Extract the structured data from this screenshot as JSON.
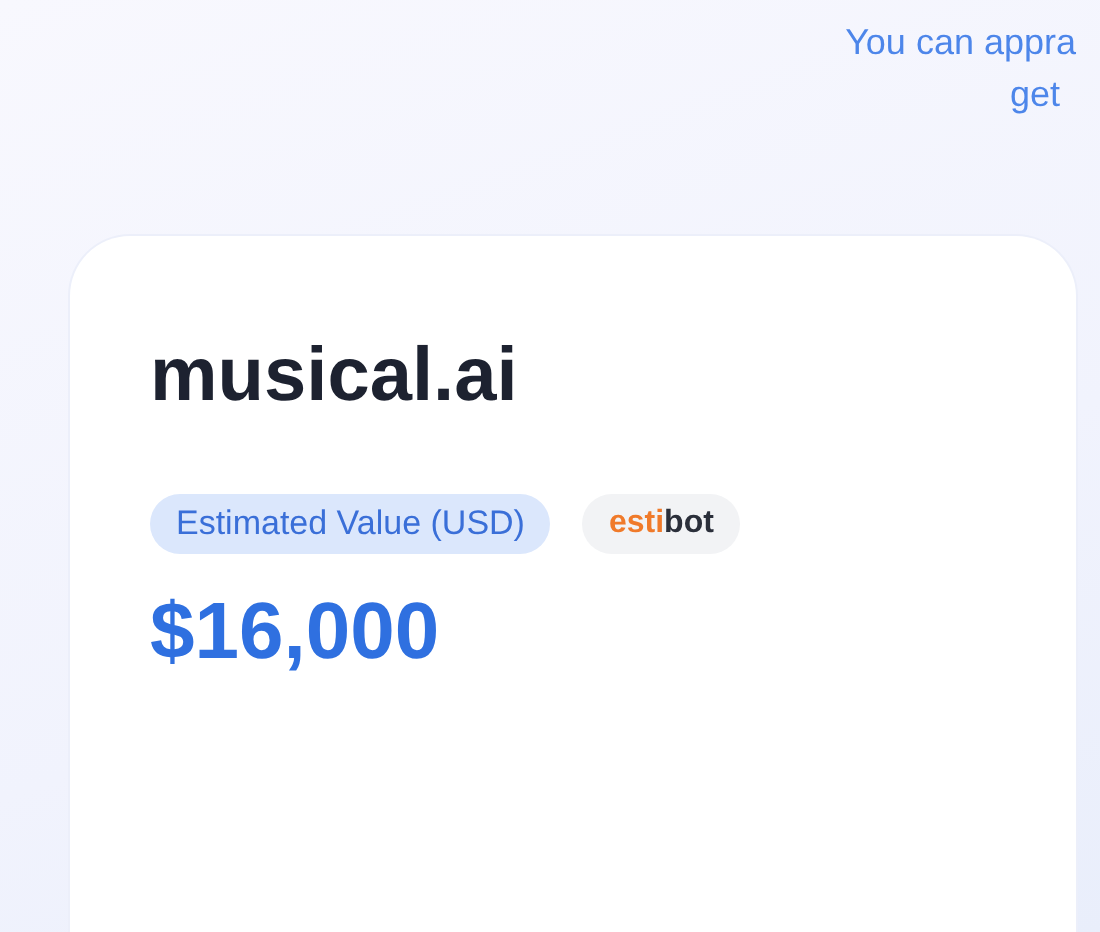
{
  "intro": {
    "lines": [
      "You can appra",
      "get"
    ]
  },
  "card": {
    "domain": "musical.ai",
    "value_label": "Estimated Value (USD)",
    "source_logo": {
      "parts": [
        {
          "text": "esti",
          "color": "#f07a2a"
        },
        {
          "text": "bot",
          "color": "#2b2f3a"
        }
      ]
    },
    "value": "$16,000"
  }
}
